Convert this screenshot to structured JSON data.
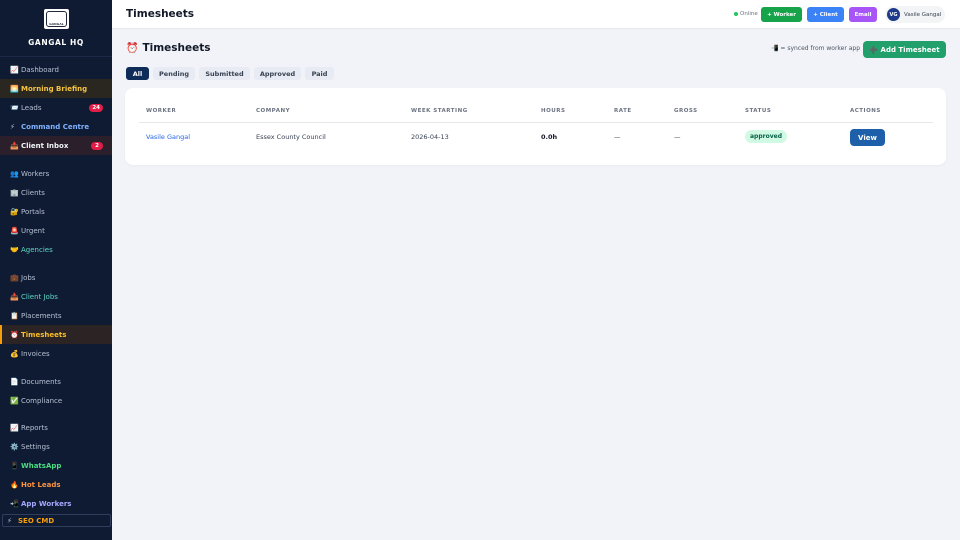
{
  "sidebar": {
    "logo_text": "GANGAL",
    "brand": "GANGAL HQ",
    "items": [
      {
        "icon": "📈",
        "label": "Dashboard"
      },
      {
        "icon": "🌅",
        "label": "Morning Briefing"
      },
      {
        "icon": "📨",
        "label": "Leads",
        "badge": "24"
      },
      {
        "icon": "⚡",
        "label": "Command Centre"
      },
      {
        "icon": "📥",
        "label": "Client Inbox",
        "badge": "2"
      },
      {
        "icon": "👥",
        "label": "Workers"
      },
      {
        "icon": "🏢",
        "label": "Clients"
      },
      {
        "icon": "🔐",
        "label": "Portals"
      },
      {
        "icon": "🚨",
        "label": "Urgent"
      },
      {
        "icon": "🤝",
        "label": "Agencies"
      },
      {
        "icon": "💼",
        "label": "Jobs"
      },
      {
        "icon": "📥",
        "label": "Client Jobs"
      },
      {
        "icon": "📋",
        "label": "Placements"
      },
      {
        "icon": "⏰",
        "label": "Timesheets"
      },
      {
        "icon": "💰",
        "label": "Invoices"
      },
      {
        "icon": "📄",
        "label": "Documents"
      },
      {
        "icon": "✅",
        "label": "Compliance"
      },
      {
        "icon": "📈",
        "label": "Reports"
      },
      {
        "icon": "⚙️",
        "label": "Settings"
      },
      {
        "icon": "📱",
        "label": "WhatsApp"
      },
      {
        "icon": "🔥",
        "label": "Hot Leads"
      },
      {
        "icon": "📲",
        "label": "App Workers"
      },
      {
        "icon": "⚡",
        "label": "SEO CMD"
      }
    ]
  },
  "topbar": {
    "title": "Timesheets",
    "online": "Online",
    "btn_worker": "+ Worker",
    "btn_client": "+ Client",
    "btn_email": "Email",
    "user_initials": "VG",
    "user_name": "Vasile Gangal"
  },
  "main": {
    "title_icon": "⏰",
    "title": "Timesheets",
    "sync_note": "📲 = synced from worker app",
    "add_button": "➕ Add Timesheet",
    "tabs": [
      "All",
      "Pending",
      "Submitted",
      "Approved",
      "Paid"
    ],
    "active_tab": "All",
    "table": {
      "headers": [
        "WORKER",
        "COMPANY",
        "WEEK STARTING",
        "HOURS",
        "RATE",
        "GROSS",
        "STATUS",
        "ACTIONS"
      ],
      "rows": [
        {
          "worker": "Vasile Gangal",
          "company": "Essex County Council",
          "week_starting": "2026-04-13",
          "hours": "0.0h",
          "rate": "—",
          "gross": "—",
          "status": "approved",
          "action": "View"
        }
      ]
    }
  },
  "colors": {
    "sidebar_bg": "#0f1b33",
    "active_accent": "#f59e0b",
    "primary": "#0f2b57",
    "add_green": "#22a06b",
    "status_approved_bg": "#d1fae5"
  }
}
